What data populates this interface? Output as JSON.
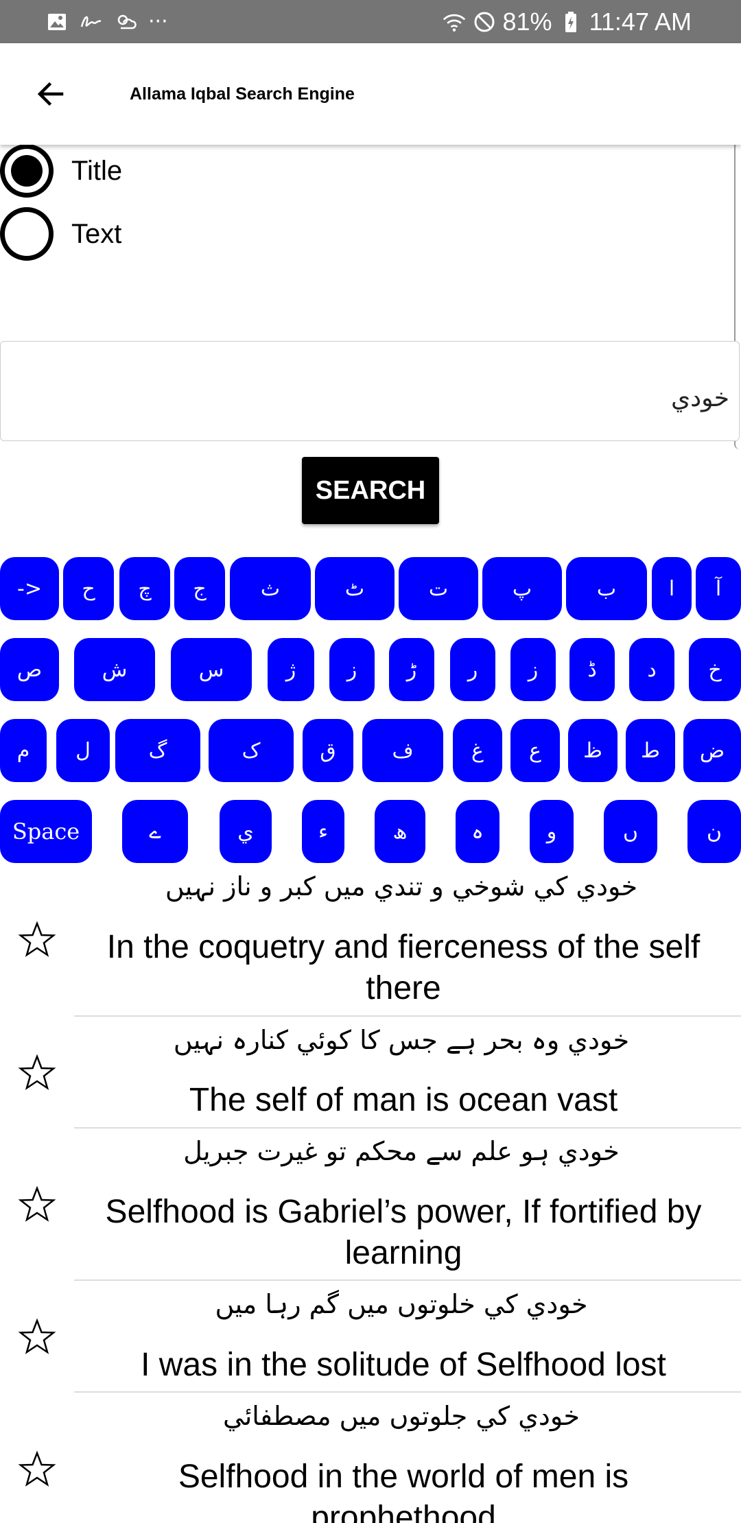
{
  "status_bar": {
    "left_icons": [
      "gallery-icon",
      "signature-icon",
      "weather-icon",
      "more-dots-icon"
    ],
    "more_text": "···",
    "battery": "81%",
    "time": "11:47 AM"
  },
  "app_bar": {
    "title": "Allama Iqbal Search Engine"
  },
  "search_mode": {
    "options": [
      {
        "label": "Title",
        "selected": true
      },
      {
        "label": "Text",
        "selected": false
      }
    ]
  },
  "search": {
    "query": "خودي",
    "button_label": "SEARCH"
  },
  "keyboard": {
    "row1": [
      "->",
      "ح",
      "چ",
      "ج",
      "ث",
      "ٹ",
      "ت",
      "پ",
      "ب",
      "ا",
      "آ"
    ],
    "row2": [
      "ص",
      "ش",
      "س",
      "ژ",
      "ز",
      "ڑ",
      "ر",
      "ز",
      "ڈ",
      "د",
      "خ"
    ],
    "row3": [
      "م",
      "ل",
      "گ",
      "ک",
      "ق",
      "ف",
      "غ",
      "ع",
      "ظ",
      "ط",
      "ض"
    ],
    "row4": [
      "Space",
      "ے",
      "ي",
      "ء",
      "ھ",
      "ہ",
      "و",
      "ں",
      "ن"
    ]
  },
  "results": [
    {
      "urdu": "خودي کي شوخي و تندي ميں کبر و ناز نہيں",
      "english": "In the coquetry and fierceness of the self there"
    },
    {
      "urdu": "خودي وہ بحر ہے جس کا کوئي کنارہ نہيں",
      "english": "The self of man is ocean vast"
    },
    {
      "urdu": "خودي ہو علم سے محکم تو غيرت جبريل",
      "english": "Selfhood is Gabriel’s power, If fortified by learning"
    },
    {
      "urdu": "خودي کي خلوتوں ميں گم رہا ميں",
      "english": "I was in the solitude of Selfhood lost"
    },
    {
      "urdu": "خودي کي جلوتوں ميں مصطفائي",
      "english": "Selfhood in the world of men is prophethood"
    }
  ],
  "colors": {
    "key_blue": "#0000ff",
    "status_bar_gray": "#757575",
    "button_black": "#000000"
  }
}
